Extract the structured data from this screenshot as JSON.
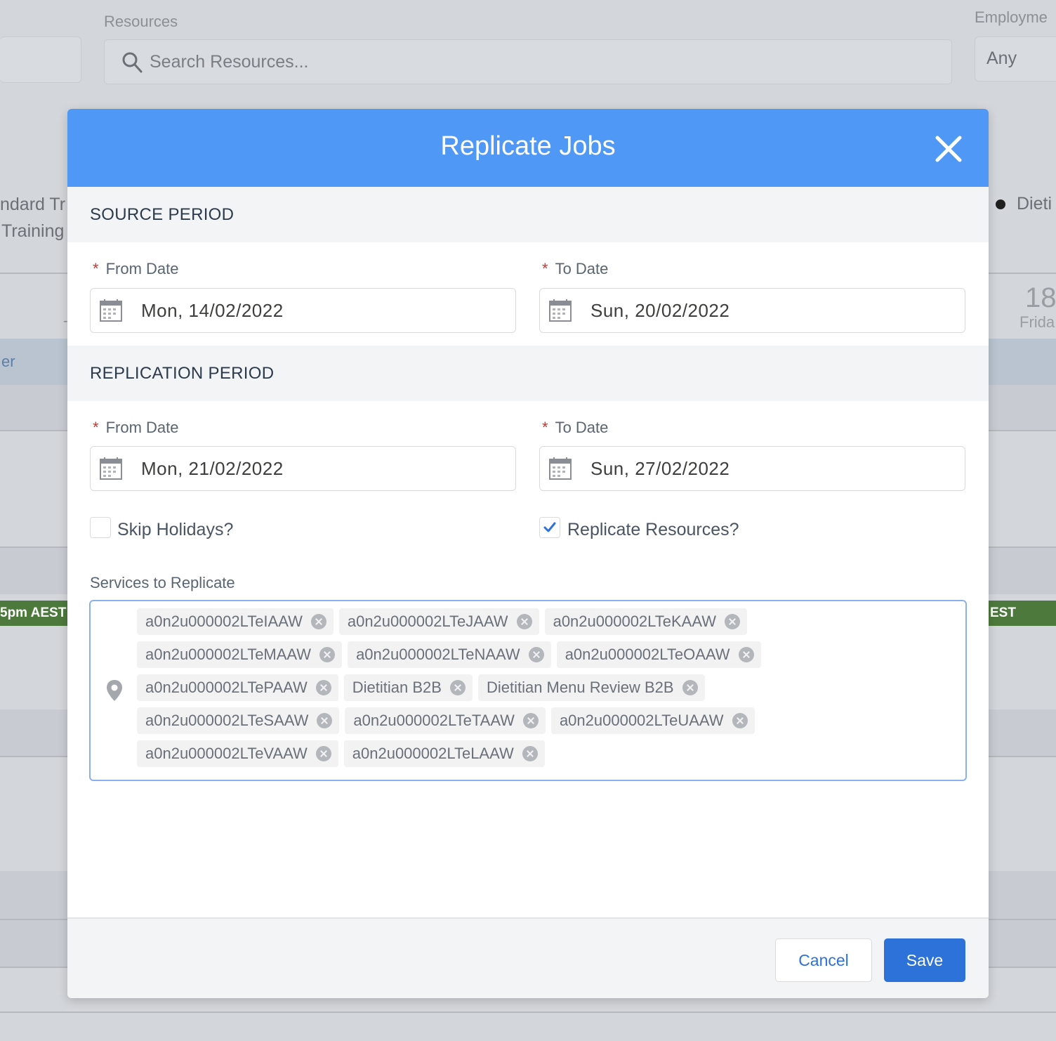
{
  "background": {
    "resources_label": "Resources",
    "search_placeholder": "Search Resources...",
    "employment_label": "Employme",
    "employment_value": "Any",
    "left_text_1": "ndard Tr",
    "left_text_2": "Training",
    "right_text": "Dieti",
    "day_number": "18",
    "day_name": "Frida",
    "left_band_text": "er",
    "green_left": "5pm AEST",
    "green_right": "EST"
  },
  "modal": {
    "title": "Replicate Jobs",
    "source_period": {
      "heading": "SOURCE PERIOD",
      "from_label": "From Date",
      "from_value": "Mon, 14/02/2022",
      "to_label": "To Date",
      "to_value": "Sun, 20/02/2022"
    },
    "replication_period": {
      "heading": "REPLICATION PERIOD",
      "from_label": "From Date",
      "from_value": "Mon, 21/02/2022",
      "to_label": "To Date",
      "to_value": "Sun, 27/02/2022"
    },
    "skip_holidays": {
      "label": "Skip Holidays?",
      "checked": false
    },
    "replicate_resources": {
      "label": "Replicate Resources?",
      "checked": true
    },
    "services": {
      "label": "Services to Replicate",
      "rows": [
        [
          "a0n2u000002LTeIAAW",
          "a0n2u000002LTeJAAW",
          "a0n2u000002LTeKAAW"
        ],
        [
          "a0n2u000002LTeMAAW",
          "a0n2u000002LTeNAAW",
          "a0n2u000002LTeOAAW"
        ],
        [
          "a0n2u000002LTePAAW",
          "Dietitian B2B",
          "Dietitian Menu Review B2B"
        ],
        [
          "a0n2u000002LTeSAAW",
          "a0n2u000002LTeTAAW",
          "a0n2u000002LTeUAAW"
        ],
        [
          "a0n2u000002LTeVAAW",
          "a0n2u000002LTeLAAW"
        ]
      ]
    },
    "cancel_label": "Cancel",
    "save_label": "Save"
  },
  "colors": {
    "header": "#4f98f5",
    "primary_button": "#2d72d9",
    "required": "#c23934"
  }
}
